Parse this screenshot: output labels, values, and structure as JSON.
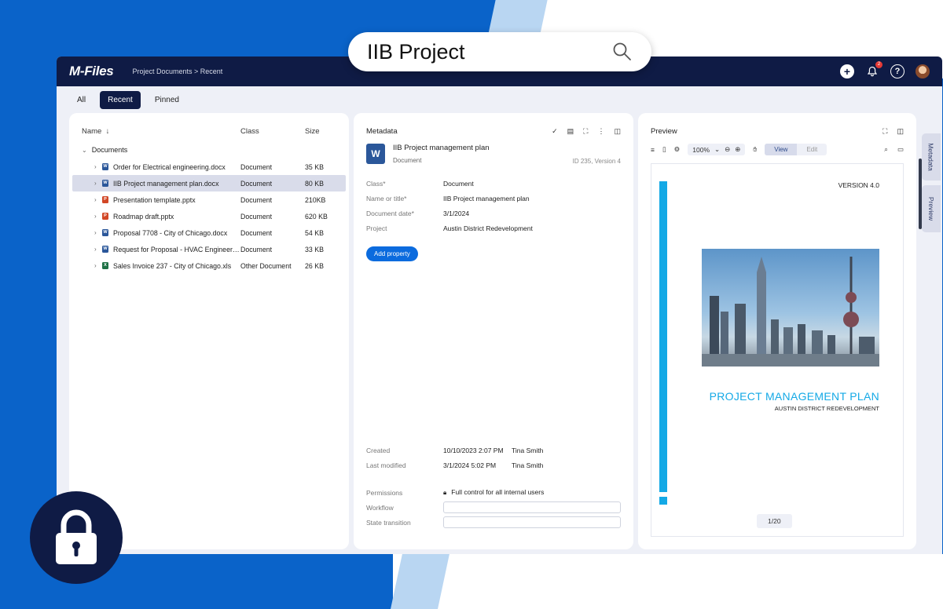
{
  "search": {
    "query": "IIB Project"
  },
  "app": {
    "logo": "M-Files",
    "breadcrumb": "Project Documents > Recent",
    "notification_count": "2"
  },
  "tabs": [
    "All",
    "Recent",
    "Pinned"
  ],
  "files": {
    "columns": {
      "name": "Name",
      "class": "Class",
      "size": "Size"
    },
    "folder": "Documents",
    "rows": [
      {
        "name": "Order for Electrical engineering.docx",
        "class": "Document",
        "size": "35 KB",
        "type": "w"
      },
      {
        "name": "IIB Project management plan.docx",
        "class": "Document",
        "size": "80 KB",
        "type": "w"
      },
      {
        "name": "Presentation template.pptx",
        "class": "Document",
        "size": "210KB",
        "type": "p"
      },
      {
        "name": "Roadmap draft.pptx",
        "class": "Document",
        "size": "620 KB",
        "type": "p"
      },
      {
        "name": "Proposal 7708 - City of Chicago.docx",
        "class": "Document",
        "size": "54 KB",
        "type": "w"
      },
      {
        "name": "Request for Proposal - HVAC Engineerin...",
        "class": "Document",
        "size": "33 KB",
        "type": "w"
      },
      {
        "name": "Sales Invoice 237 - City of Chicago.xls",
        "class": "Other Document",
        "size": "26 KB",
        "type": "x"
      }
    ]
  },
  "metadata": {
    "title": "Metadata",
    "doc_title": "IIB Project management plan",
    "doc_class": "Document",
    "doc_id": "ID 235, Version 4",
    "props": [
      {
        "key": "Class*",
        "value": "Document"
      },
      {
        "key": "Name or title*",
        "value": "IIB Project management plan"
      },
      {
        "key": "Document date*",
        "value": "3/1/2024"
      },
      {
        "key": "Project",
        "value": "Austin District Redevelopment"
      }
    ],
    "add_property": "Add property",
    "created_label": "Created",
    "created_date": "10/10/2023 2:07 PM",
    "created_by": "Tina Smith",
    "modified_label": "Last modified",
    "modified_date": "3/1/2024 5:02 PM",
    "modified_by": "Tina Smith",
    "permissions_label": "Permissions",
    "permissions_value": "Full control for all internal users",
    "workflow_label": "Workflow",
    "state_label": "State transition"
  },
  "preview": {
    "title": "Preview",
    "zoom": "100%",
    "view": "View",
    "edit": "Edit",
    "version": "VERSION 4.0",
    "doc_heading": "PROJECT MANAGEMENT PLAN",
    "doc_subheading": "AUSTIN DISTRICT REDEVELOPMENT",
    "page": "1/20"
  },
  "side_tabs": [
    "Metadata",
    "Preview"
  ],
  "colors": {
    "brand_navy": "#0f1b45",
    "accent_blue": "#0b6bde",
    "doc_cyan": "#14a9e6"
  }
}
